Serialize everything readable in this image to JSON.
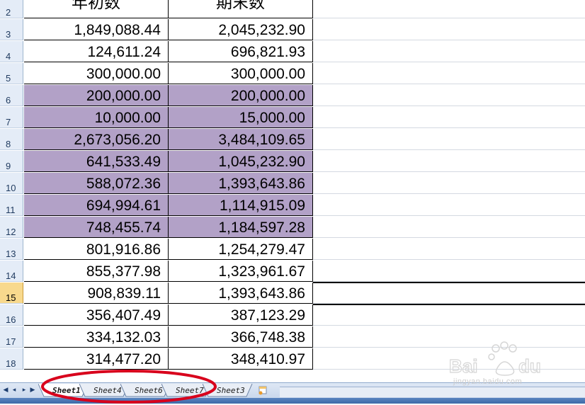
{
  "header": {
    "col_a": "年初数",
    "col_b": "期末数",
    "row_number": "2"
  },
  "rows": [
    {
      "num": "3",
      "a": "1,849,088.44",
      "b": "2,045,232.90",
      "highlight": false
    },
    {
      "num": "4",
      "a": "124,611.24",
      "b": "696,821.93",
      "highlight": false
    },
    {
      "num": "5",
      "a": "300,000.00",
      "b": "300,000.00",
      "highlight": false
    },
    {
      "num": "6",
      "a": "200,000.00",
      "b": "200,000.00",
      "highlight": true
    },
    {
      "num": "7",
      "a": "10,000.00",
      "b": "15,000.00",
      "highlight": true
    },
    {
      "num": "8",
      "a": "2,673,056.20",
      "b": "3,484,109.65",
      "highlight": true
    },
    {
      "num": "9",
      "a": "641,533.49",
      "b": "1,045,232.90",
      "highlight": true
    },
    {
      "num": "10",
      "a": "588,072.36",
      "b": "1,393,643.86",
      "highlight": true
    },
    {
      "num": "11",
      "a": "694,994.61",
      "b": "1,114,915.09",
      "highlight": true
    },
    {
      "num": "12",
      "a": "748,455.74",
      "b": "1,184,597.28",
      "highlight": true
    },
    {
      "num": "13",
      "a": "801,916.86",
      "b": "1,254,279.47",
      "highlight": false
    },
    {
      "num": "14",
      "a": "855,377.98",
      "b": "1,323,961.67",
      "highlight": false
    },
    {
      "num": "15",
      "a": "908,839.11",
      "b": "1,393,643.86",
      "highlight": false,
      "active": true
    },
    {
      "num": "16",
      "a": "356,407.49",
      "b": "387,123.29",
      "highlight": false
    },
    {
      "num": "17",
      "a": "334,132.03",
      "b": "366,748.38",
      "highlight": false
    },
    {
      "num": "18",
      "a": "314,477.20",
      "b": "348,410.97",
      "highlight": false
    }
  ],
  "sheet_tabs": [
    "Sheet1",
    "Sheet4",
    "Sheet6",
    "Sheet7",
    "Sheet3"
  ],
  "active_tab": "Sheet1",
  "watermark": {
    "url_text": "jingyan.baidu.com"
  },
  "colors": {
    "highlight": "#b2a1c7",
    "annotation": "#d8001c",
    "active_row_header": "#f8d98d"
  },
  "icons": [
    "first-sheet-icon",
    "prev-sheet-icon",
    "next-sheet-icon",
    "last-sheet-icon",
    "insert-sheet-icon"
  ]
}
